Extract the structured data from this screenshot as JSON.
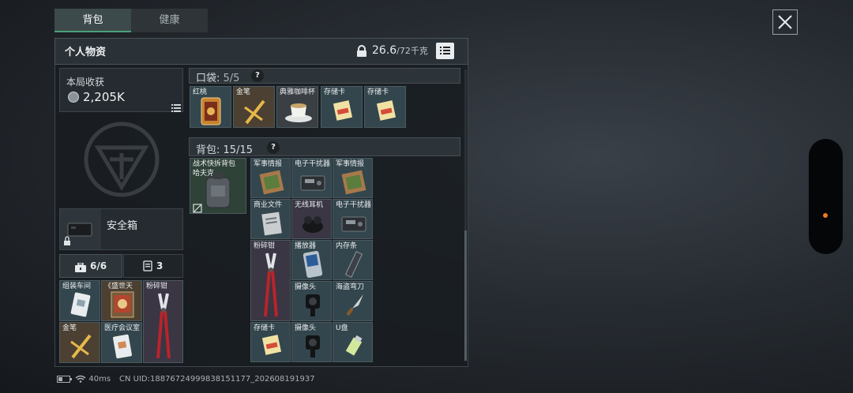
{
  "tabs": {
    "bag": "背包",
    "health": "健康"
  },
  "panel": {
    "title": "个人物资",
    "weight_current": "26.6",
    "weight_max": "/72千克"
  },
  "earnings": {
    "title": "本局收获",
    "value": "2,205K"
  },
  "safe": {
    "label": "安全箱"
  },
  "subtabs": {
    "a_count": "6/6",
    "b_count": "3"
  },
  "safe_items": [
    "组装车间",
    "《盛世天",
    "粉碎钳",
    "金笔",
    "医疗会议室"
  ],
  "pocket": {
    "label": "口袋:",
    "count": "5/5",
    "help": "?",
    "items": [
      "红桃",
      "金笔",
      "典雅咖啡杯",
      "存储卡",
      "存储卡"
    ]
  },
  "backpack": {
    "label": "背包:",
    "count": "15/15",
    "help": "?",
    "bag_name": "战术快拆背包 哈夫克",
    "items": [
      "军事情报",
      "电子干扰器",
      "军事情报",
      "商业文件",
      "无线耳机",
      "电子干扰器",
      "粉碎钳",
      "播放器",
      "内存条",
      "摄像头",
      "海盗弯刀",
      "存储卡",
      "摄像头",
      "U盘"
    ]
  },
  "status": {
    "ping": "40ms",
    "uid": "CN UID:18876724999838151177_202608191937"
  },
  "colors": {
    "accent_green": "#49a07a",
    "orange_dot": "#f07a1e"
  },
  "icons": [
    "close-icon",
    "lock-icon",
    "list-icon",
    "coin-icon",
    "toolbox-icon",
    "card-icon",
    "battery-icon",
    "wifi-icon",
    "help-icon"
  ]
}
